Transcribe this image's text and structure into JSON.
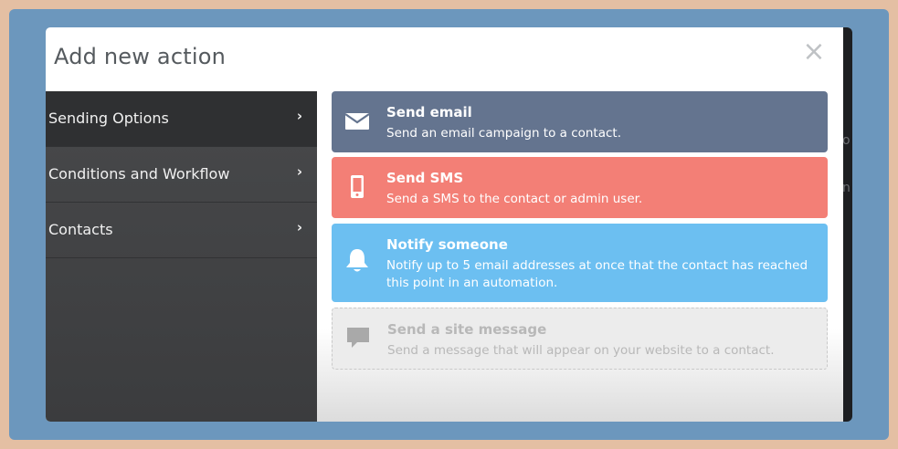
{
  "modal": {
    "title": "Add new action",
    "close_label": "×"
  },
  "sidebar": {
    "items": [
      {
        "label": "Sending Options",
        "chevron": "›",
        "active": true
      },
      {
        "label": "Conditions and Workflow",
        "chevron": "›",
        "active": false
      },
      {
        "label": "Contacts",
        "chevron": "›",
        "active": false
      }
    ]
  },
  "actions": {
    "email": {
      "title": "Send email",
      "description": "Send an email campaign to a contact.",
      "icon": "envelope-icon",
      "color": "#64748f"
    },
    "sms": {
      "title": "Send SMS",
      "description": "Send a SMS to the contact or admin user.",
      "icon": "mobile-phone-icon",
      "color": "#f37f76"
    },
    "notify": {
      "title": "Notify someone",
      "description": "Notify up to 5 email addresses at once that the contact has reached this point in an automation.",
      "icon": "bell-icon",
      "color": "#6cbff1"
    },
    "site_message": {
      "title": "Send a site message",
      "description": "Send a message that will appear on your website to a contact.",
      "icon": "chat-bubble-icon",
      "color": "#ececec"
    }
  },
  "background": {
    "ghost_texts": [
      "o",
      "n"
    ]
  }
}
